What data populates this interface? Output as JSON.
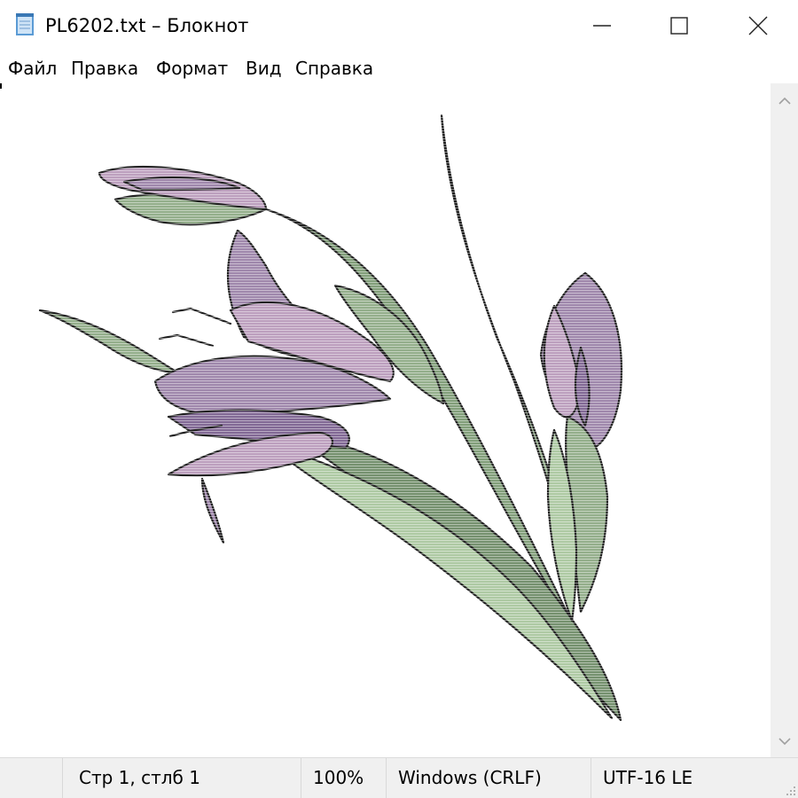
{
  "window": {
    "title": "PL6202.txt – Блокнот"
  },
  "menu": {
    "items": [
      "Файл",
      "Правка",
      "Формат",
      "Вид",
      "Справка"
    ]
  },
  "status": {
    "position": "Стр 1, стлб 1",
    "zoom": "100%",
    "line_endings": "Windows (CRLF)",
    "encoding": "UTF-16 LE"
  },
  "icons": {
    "app": "notepad-icon",
    "minimize": "minimize-icon",
    "maximize": "maximize-icon",
    "close": "close-icon",
    "scroll_up": "chevron-up-icon",
    "scroll_down": "chevron-down-icon",
    "grip": "resize-grip-icon"
  },
  "colors": {
    "petal": "#9b82a8",
    "petal_dark": "#7c6290",
    "petal_light": "#b99bbb",
    "leaf": "#8fab86",
    "leaf_dark": "#6f8c68",
    "leaf_light": "#aac79f",
    "outline": "#161616"
  }
}
